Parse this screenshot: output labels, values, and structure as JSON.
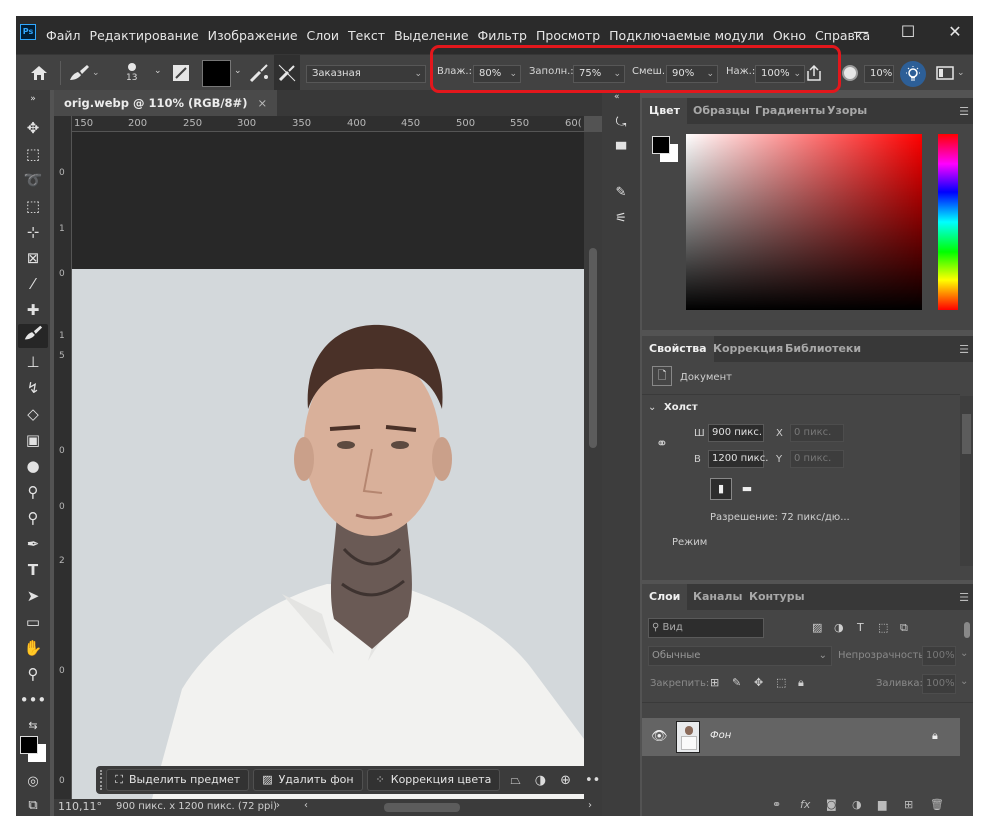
{
  "app": {
    "logo": "Ps"
  },
  "menu": [
    "Файл",
    "Редактирование",
    "Изображение",
    "Слои",
    "Текст",
    "Выделение",
    "Фильтр",
    "Просмотр",
    "Подключаемые модули",
    "Окно",
    "Справка"
  ],
  "window_controls": {
    "minimize": "—",
    "maximize": "☐",
    "close": "✕"
  },
  "options": {
    "brush_size": "13",
    "preset": "Заказная",
    "wet_label": "Влаж.:",
    "wet_value": "80%",
    "fill_label": "Заполн.:",
    "fill_value": "75%",
    "mix_label": "Смеш.:",
    "mix_value": "90%",
    "press_label": "Наж.:",
    "press_value": "100%",
    "smoothing": "10%",
    "highlight_color": "#e3171c"
  },
  "document": {
    "tab_title": "orig.webp @ 110% (RGB/8#)",
    "tab_close": "×",
    "ruler_ticks": [
      "150",
      "200",
      "250",
      "300",
      "350",
      "400",
      "450",
      "500",
      "550",
      "60("
    ],
    "ruler_v": [
      "0",
      "1",
      "0",
      "1",
      "5",
      "0",
      "0",
      "2",
      "0",
      "0"
    ],
    "zoom": "110,11°",
    "dimensions": "900 пикс. x 1200 пикс. (72 ppi)"
  },
  "context_bar": {
    "select_subject": "Выделить предмет",
    "remove_bg": "Удалить фон",
    "color_correction": "Коррекция цвета"
  },
  "color_panel": {
    "tabs": [
      "Цвет",
      "Образцы",
      "Градиенты",
      "Узоры"
    ],
    "fg": "#000000",
    "bg": "#ffffff",
    "hue": "#ff0000"
  },
  "properties_panel": {
    "tabs": [
      "Свойства",
      "Коррекция",
      "Библиотеки"
    ],
    "doc_label": "Документ",
    "canvas_label": "Холст",
    "w_label": "Ш",
    "w_value": "900 пикс.",
    "h_label": "В",
    "h_value": "1200 пикс.",
    "x_label": "X",
    "x_value": "0 пикс.",
    "y_label": "Y",
    "y_value": "0 пикс.",
    "resolution": "Разрешение: 72 пикс/дю...",
    "mode": "Режим"
  },
  "layers_panel": {
    "tabs": [
      "Слои",
      "Каналы",
      "Контуры"
    ],
    "search_placeholder": "Вид",
    "blend_mode": "Обычные",
    "opacity_label": "Непрозрачность:",
    "opacity_value": "100%",
    "lock_label": "Закрепить:",
    "fill_label": "Заливка:",
    "fill_value": "100%",
    "layer_name": "Фон"
  }
}
